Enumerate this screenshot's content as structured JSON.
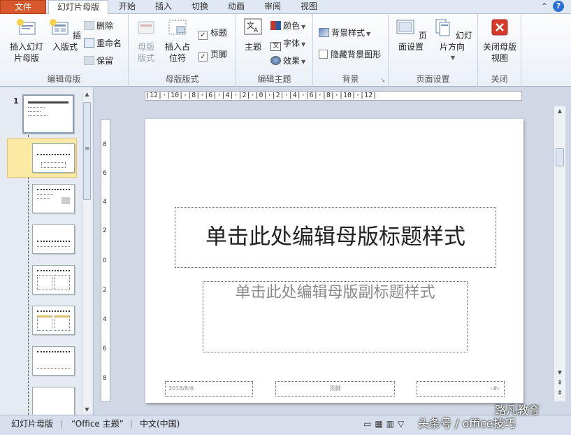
{
  "tabs": [
    "文件",
    "幻灯片母版",
    "开始",
    "插入",
    "切换",
    "动画",
    "审阅",
    "视图"
  ],
  "ribbon": {
    "edit_master": {
      "label": "编辑母版",
      "insert_slide_master": "插入幻灯片母版",
      "insert_layout": "插入版式",
      "delete": "删除",
      "rename": "重命名",
      "preserve": "保留"
    },
    "master_layout": {
      "label": "母版版式",
      "master_layout_btn": "母版版式",
      "insert_placeholder": "插入占位符",
      "title_check": "标题",
      "footer_check": "页脚"
    },
    "edit_theme": {
      "label": "编辑主题",
      "theme": "主题",
      "colors": "颜色",
      "fonts": "字体",
      "effects": "效果"
    },
    "background": {
      "label": "背景",
      "bg_styles": "背景样式",
      "hide_bg": "隐藏背景图形"
    },
    "page_setup": {
      "label": "页面设置",
      "page_setup_btn": "页面设置",
      "orientation": "幻灯片方向"
    },
    "close": {
      "label": "关闭",
      "close_btn": "关闭母版视图"
    }
  },
  "thumbs": {
    "first_number": "1"
  },
  "ruler_text": "|12|·|10|·|8|·|6|·|4|·|2|·|0|·|2|·|4|·|6|·|8|·|10|·|12|",
  "vruler": [
    "8",
    "6",
    "4",
    "2",
    "0",
    "2",
    "4",
    "6",
    "8"
  ],
  "slide": {
    "title": "单击此处编辑母版标题样式",
    "subtitle": "单击此处编辑母版副标题样式",
    "date": "2018/8/6",
    "footer": "页脚",
    "number": "‹#›"
  },
  "status": {
    "view": "幻灯片母版",
    "theme": "“Office 主题”",
    "lang": "中文(中国)"
  },
  "watermark": {
    "line1": "路凡教育",
    "line2": "头条号 / office技巧"
  }
}
